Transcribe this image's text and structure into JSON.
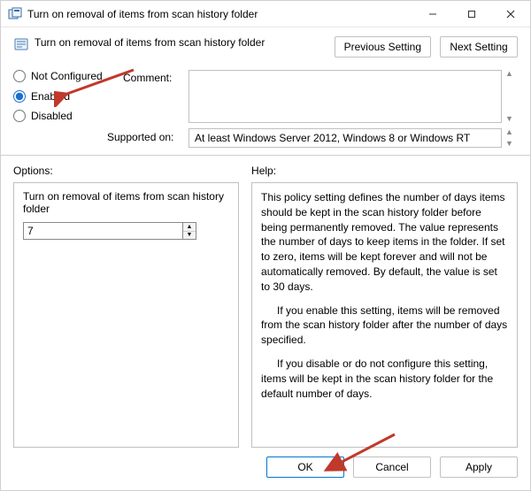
{
  "window": {
    "title": "Turn on removal of items from scan history folder"
  },
  "header": {
    "title": "Turn on removal of items from scan history folder",
    "prev_label": "Previous Setting",
    "next_label": "Next Setting"
  },
  "state": {
    "not_configured": "Not Configured",
    "enabled": "Enabled",
    "disabled": "Disabled",
    "selected": "enabled"
  },
  "comment": {
    "label": "Comment:",
    "value": ""
  },
  "supported": {
    "label": "Supported on:",
    "value": "At least Windows Server 2012, Windows 8 or Windows RT"
  },
  "options": {
    "section_label": "Options:",
    "title": "Turn on removal of items from scan history folder",
    "value": "7"
  },
  "help": {
    "section_label": "Help:",
    "p1": "This policy setting defines the number of days items should be kept in the scan history folder before being permanently removed. The value represents the number of days to keep items in the folder. If set to zero, items will be kept forever and will not be automatically removed. By default, the value is set to 30 days.",
    "p2": "If you enable this setting, items will be removed from the scan history folder after the number of days specified.",
    "p3": "If you disable or do not configure this setting, items will be kept in the scan history folder for the default number of days."
  },
  "buttons": {
    "ok": "OK",
    "cancel": "Cancel",
    "apply": "Apply"
  },
  "icons": {
    "app": "policy-icon",
    "minimize": "minimize-icon",
    "maximize": "maximize-icon",
    "close": "close-icon"
  },
  "colors": {
    "accent": "#1a6fd1",
    "arrow": "#c0392b"
  }
}
